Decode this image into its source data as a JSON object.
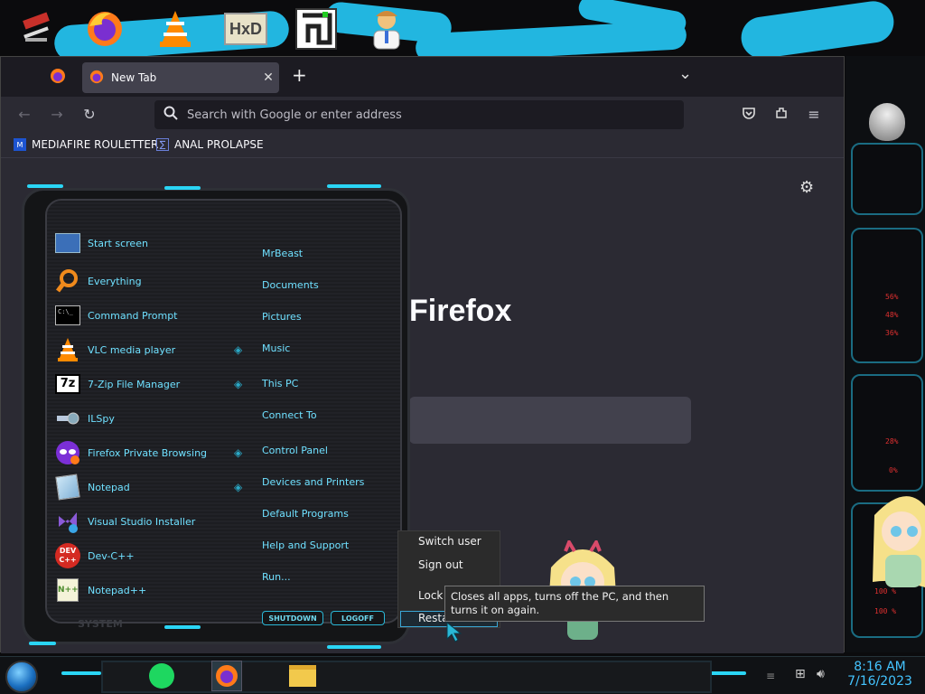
{
  "desktop": {
    "icons": [
      "settings-tools-icon",
      "firefox-icon",
      "vlc-icon",
      "hxd-icon",
      "maze-icon",
      "doctor-icon"
    ]
  },
  "browser": {
    "tab_title": "New Tab",
    "tab_close": "✕",
    "new_tab": "+",
    "tab_list": "⌄",
    "url_placeholder": "Search with Google or enter address",
    "bookmarks": [
      {
        "label": "MEDIAFIRE ROULETTER",
        "icon_text": "MF\nT"
      },
      {
        "label": "ANAL PROLAPSE",
        "icon_text": "∑"
      }
    ],
    "brand_text": "Firefox"
  },
  "start_menu": {
    "left_items": [
      {
        "label": "Start screen",
        "icon": "start-screen-icon"
      },
      {
        "label": "Everything",
        "icon": "everything-search-icon"
      },
      {
        "label": "Command Prompt",
        "icon": "cmd-icon"
      },
      {
        "label": "VLC media player",
        "icon": "vlc-icon"
      },
      {
        "label": "7-Zip File Manager",
        "icon": "7zip-icon"
      },
      {
        "label": "ILSpy",
        "icon": "ilspy-icon"
      },
      {
        "label": "Firefox Private Browsing",
        "icon": "firefox-private-icon"
      },
      {
        "label": "Notepad",
        "icon": "notepad-icon"
      },
      {
        "label": "Visual Studio Installer",
        "icon": "vs-installer-icon"
      },
      {
        "label": "Dev-C++",
        "icon": "devcpp-icon"
      },
      {
        "label": "Notepad++",
        "icon": "notepadpp-icon"
      }
    ],
    "right_items": [
      {
        "label": "MrBeast",
        "arrow": false
      },
      {
        "label": "Documents",
        "arrow": false
      },
      {
        "label": "Pictures",
        "arrow": false
      },
      {
        "label": "Music",
        "arrow": true
      },
      {
        "label": "This PC",
        "arrow": true
      },
      {
        "label": "Connect To",
        "arrow": false
      },
      {
        "label": "Control Panel",
        "arrow": true
      },
      {
        "label": "Devices and Printers",
        "arrow": true
      },
      {
        "label": "Default Programs",
        "arrow": false
      },
      {
        "label": "Help and Support",
        "arrow": false
      },
      {
        "label": "Run...",
        "arrow": false
      }
    ],
    "system_label": "SYSTEM",
    "shutdown_label": "SHUTDOWN",
    "logoff_label": "LOGOFF"
  },
  "power_menu": {
    "items": [
      "Switch user",
      "Sign out",
      "Lock",
      "Restart"
    ],
    "tooltip": "Closes all apps, turns off the PC, and then turns it on again."
  },
  "right_panel": {
    "readouts": [
      "56%",
      "48%",
      "36%",
      "28%",
      "0%",
      "100 %",
      "100 %"
    ]
  },
  "taskbar": {
    "time": "8:16 AM",
    "date": "7/16/2023"
  },
  "colors": {
    "accent": "#2ad5f5",
    "menu_text": "#6fe0ff",
    "clock": "#44c4ff"
  }
}
